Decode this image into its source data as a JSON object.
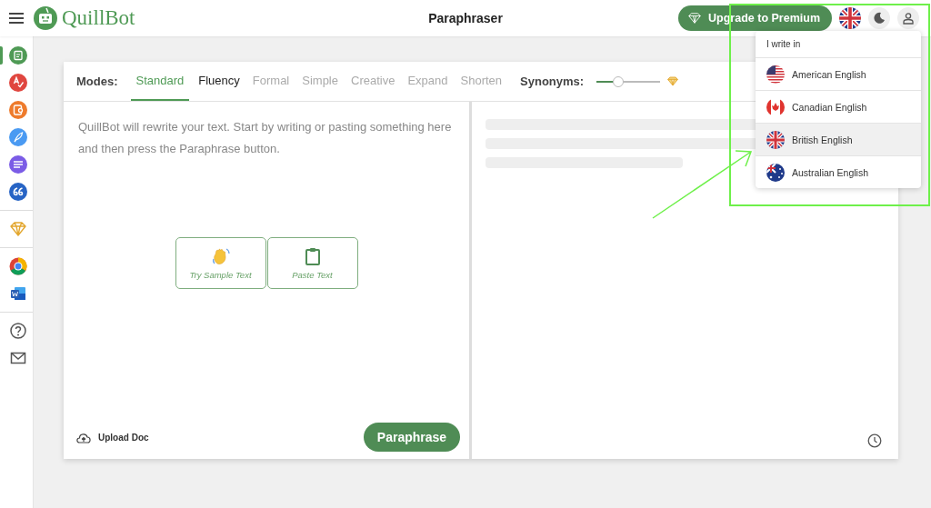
{
  "header": {
    "logo_text": "QuillBot",
    "title": "Paraphraser",
    "premium_button": "Upgrade to Premium",
    "language": {
      "kind": "uk"
    }
  },
  "sidebar": {
    "groups": [
      [
        {
          "kind": "paraphraser",
          "color": "#4f9a55",
          "selected": true
        },
        {
          "kind": "grammar",
          "color": "#e0463f",
          "selected": false
        },
        {
          "kind": "plagiarism",
          "color": "#ee7b2c",
          "selected": false
        },
        {
          "kind": "writer",
          "color": "#4a9af2",
          "selected": false
        },
        {
          "kind": "summarizer",
          "color": "#7b5ce6",
          "selected": false
        },
        {
          "kind": "citation",
          "color": "#2764c5",
          "selected": false
        }
      ],
      [
        {
          "kind": "premium",
          "color": "#e3a72f",
          "selected": false
        }
      ],
      [
        {
          "kind": "chrome",
          "selected": false
        },
        {
          "kind": "word",
          "color": "#2b5fb4",
          "selected": false
        }
      ],
      [
        {
          "kind": "help",
          "color": "#555555",
          "selected": false
        },
        {
          "kind": "mail",
          "color": "#555555",
          "selected": false
        }
      ]
    ]
  },
  "modes": {
    "label": "Modes:",
    "items": [
      {
        "label": "Standard",
        "selected": true,
        "locked": false
      },
      {
        "label": "Fluency",
        "selected": false,
        "locked": false
      },
      {
        "label": "Formal",
        "selected": false,
        "locked": true
      },
      {
        "label": "Simple",
        "selected": false,
        "locked": true
      },
      {
        "label": "Creative",
        "selected": false,
        "locked": true
      },
      {
        "label": "Expand",
        "selected": false,
        "locked": true
      },
      {
        "label": "Shorten",
        "selected": false,
        "locked": true
      }
    ]
  },
  "synonyms": {
    "label": "Synonyms:",
    "level": 0.34
  },
  "input": {
    "placeholder": "QuillBot will rewrite your text. Start by writing or pasting something here and then press the Paraphrase button."
  },
  "actions": [
    {
      "kind": "sample",
      "label": "Try Sample Text"
    },
    {
      "kind": "paste",
      "label": "Paste Text"
    }
  ],
  "upload": "Upload Doc",
  "paraphrase_button": "Paraphrase",
  "language_menu": {
    "heading": "I write in",
    "items": [
      {
        "label": "American English",
        "kind": "us",
        "selected": false
      },
      {
        "label": "Canadian English",
        "kind": "ca",
        "selected": false
      },
      {
        "label": "British English",
        "kind": "uk",
        "selected": true
      },
      {
        "label": "Australian English",
        "kind": "au",
        "selected": false
      }
    ]
  }
}
